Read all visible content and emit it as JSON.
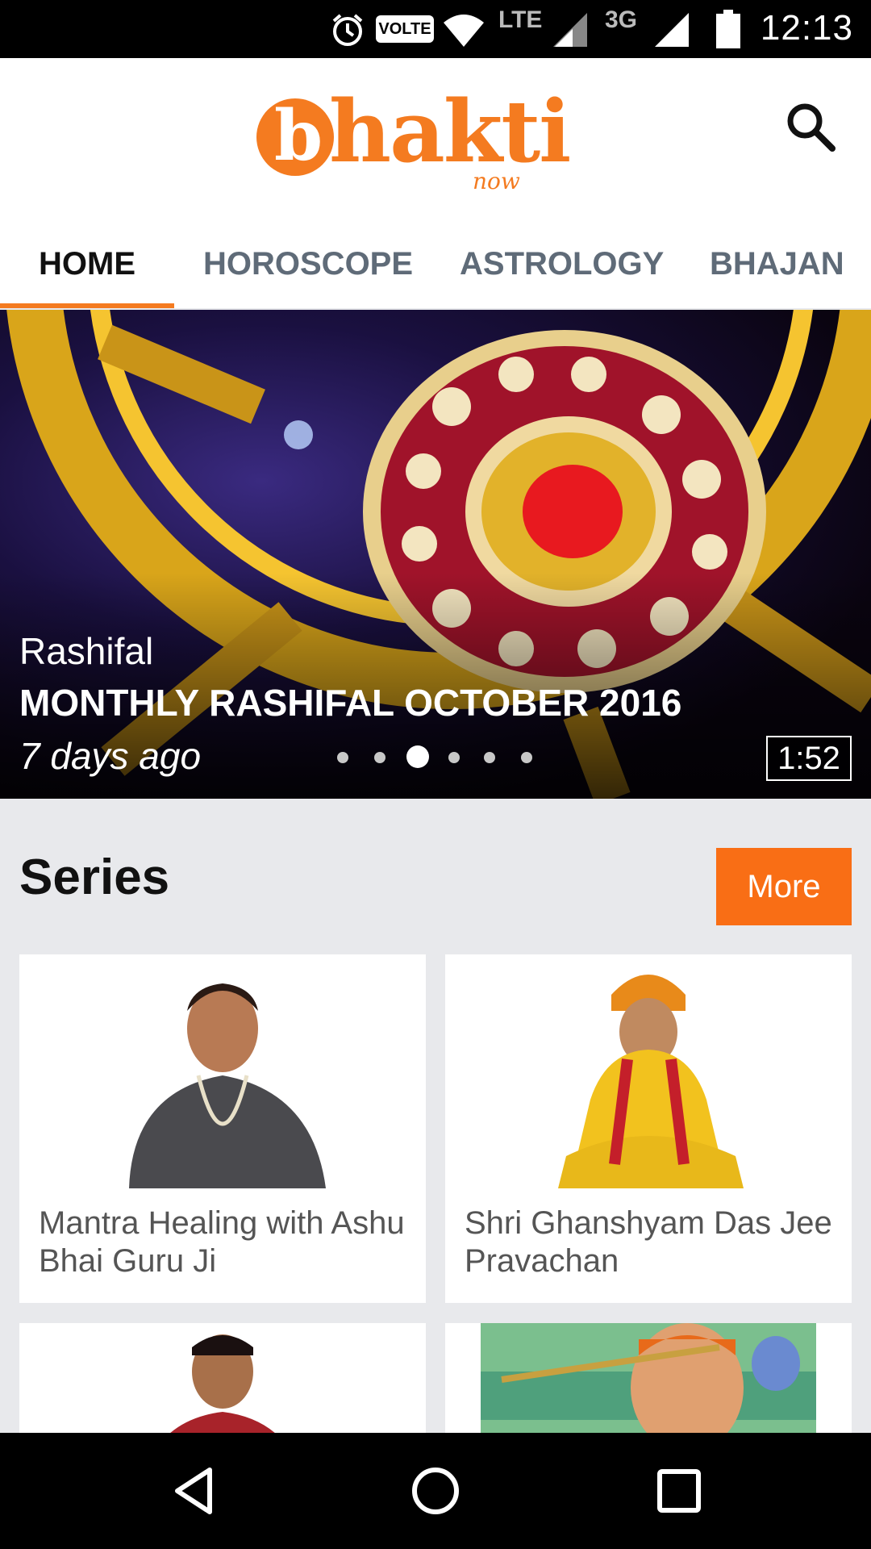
{
  "status_bar": {
    "time": "12:13",
    "volte_label": "VOLTE",
    "network_1": "LTE",
    "network_2": "3G",
    "icons": [
      "alarm-icon",
      "wifi-icon",
      "signal-icon",
      "battery-icon"
    ]
  },
  "header": {
    "logo_letter": "b",
    "logo_text": "hakti",
    "logo_sub": "now",
    "search_icon": "search-icon",
    "brand_color": "#f47b20"
  },
  "tabs": [
    {
      "label": "HOME",
      "active": true
    },
    {
      "label": "HOROSCOPE",
      "active": false
    },
    {
      "label": "ASTROLOGY",
      "active": false
    },
    {
      "label": "BHAJAN",
      "active": false
    }
  ],
  "hero": {
    "category": "Rashifal",
    "title": "MONTHLY RASHIFAL OCTOBER 2016",
    "time_ago": "7 days ago",
    "duration": "1:52",
    "slide_count": 6,
    "active_slide": 3
  },
  "series": {
    "heading": "Series",
    "more_label": "More",
    "more_color": "#f96e15",
    "cards": [
      {
        "title": "Mantra Healing with Ashu Bhai Guru Ji"
      },
      {
        "title": "Shri Ghanshyam Das Jee Pravachan"
      },
      {
        "title": ""
      },
      {
        "title": ""
      }
    ]
  },
  "nav_bar": {
    "icons": [
      "back-icon",
      "home-icon",
      "recents-icon"
    ]
  }
}
